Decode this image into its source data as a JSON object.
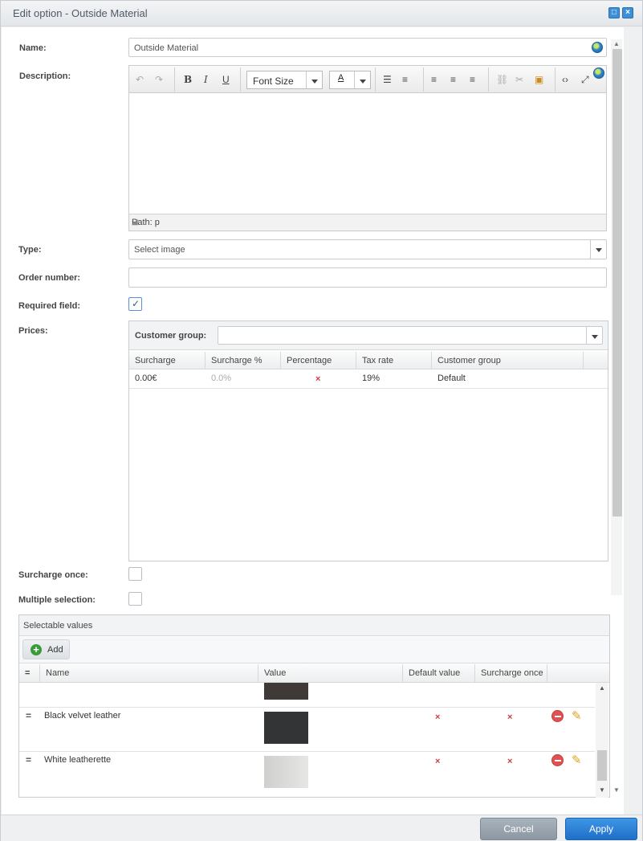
{
  "window": {
    "title": "Edit option - Outside Material",
    "maximize_icon": "maximize-icon",
    "close_icon": "close-icon"
  },
  "form": {
    "name_label": "Name:",
    "name_value": "Outside Material",
    "description_label": "Description:",
    "editor": {
      "font_size_label": "Font Size",
      "font_color_letter": "A",
      "path_text": "Path: p"
    },
    "type_label": "Type:",
    "type_value": "Select image",
    "order_label": "Order number:",
    "order_value": "",
    "required_label": "Required field:",
    "required_checked": true,
    "prices_label": "Prices:",
    "surcharge_once_label": "Surcharge once:",
    "multiple_selection_label": "Multiple selection:"
  },
  "prices": {
    "customer_group_label": "Customer group:",
    "customer_group_value": "",
    "columns": [
      "Surcharge",
      "Surcharge %",
      "Percentage",
      "Tax rate",
      "Customer group"
    ],
    "rows": [
      {
        "surcharge": "0.00€",
        "surcharge_pct": "0.0%",
        "percentage": "×",
        "tax_rate": "19%",
        "customer_group": "Default"
      }
    ]
  },
  "selectable_values": {
    "title": "Selectable values",
    "add_label": "Add",
    "columns": [
      "Name",
      "Value",
      "Default value",
      "Surcharge once"
    ],
    "drag_glyph": "=",
    "rows": [
      {
        "name": "",
        "swatch": "#3f3a38",
        "default": "",
        "once": ""
      },
      {
        "name": "Black velvet leather",
        "swatch": "#333435",
        "default": "×",
        "once": "×"
      },
      {
        "name": "White leatherette",
        "swatch": "#d9d9d7",
        "default": "×",
        "once": "×"
      }
    ]
  },
  "buttons": {
    "cancel": "Cancel",
    "apply": "Apply"
  }
}
